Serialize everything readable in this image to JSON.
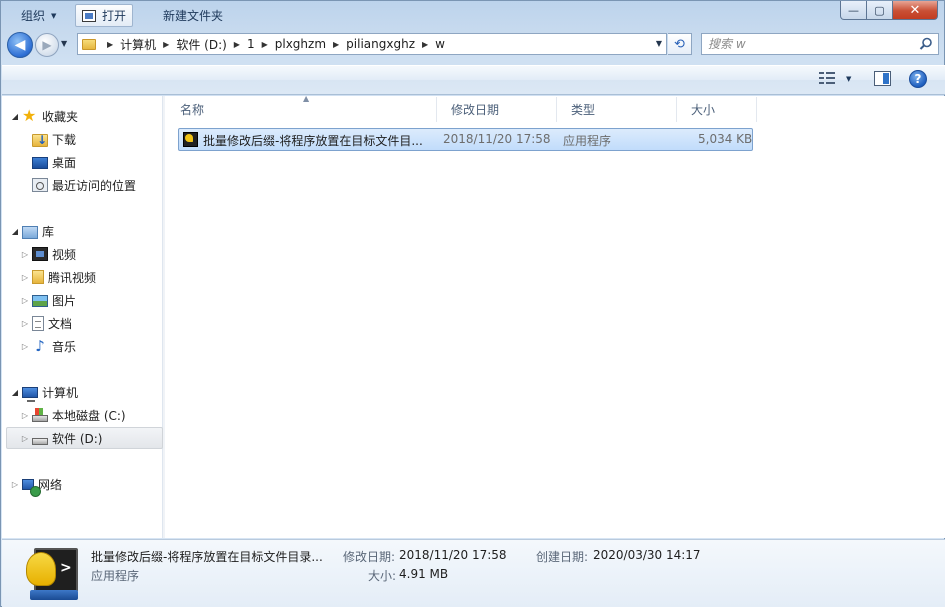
{
  "window": {
    "controls": {
      "minimize": "—",
      "maximize": "▢",
      "close": "✕"
    }
  },
  "address": {
    "crumbs": [
      "计算机",
      "软件 (D:)",
      "1",
      "plxghzm",
      "piliangxghz",
      "w"
    ]
  },
  "search": {
    "placeholder": "搜索 w"
  },
  "toolbar": {
    "organize": "组织",
    "open": "打开",
    "new_folder": "新建文件夹"
  },
  "nav": {
    "favorites": {
      "label": "收藏夹",
      "items": [
        "下载",
        "桌面",
        "最近访问的位置"
      ]
    },
    "libraries": {
      "label": "库",
      "items": [
        "视频",
        "腾讯视频",
        "图片",
        "文档",
        "音乐"
      ]
    },
    "computer": {
      "label": "计算机",
      "items": [
        "本地磁盘 (C:)",
        "软件 (D:)"
      ]
    },
    "network": {
      "label": "网络"
    }
  },
  "columns": {
    "name": "名称",
    "modified": "修改日期",
    "type": "类型",
    "size": "大小"
  },
  "files": [
    {
      "name": "批量修改后缀-将程序放置在目标文件目...",
      "modified": "2018/11/20 17:58",
      "type": "应用程序",
      "size": "5,034 KB"
    }
  ],
  "details": {
    "name": "批量修改后缀-将程序放置在目标文件目录...",
    "type": "应用程序",
    "modified_label": "修改日期:",
    "modified": "2018/11/20 17:58",
    "created_label": "创建日期:",
    "created": "2020/03/30 14:17",
    "size_label": "大小:",
    "size": "4.91 MB"
  }
}
